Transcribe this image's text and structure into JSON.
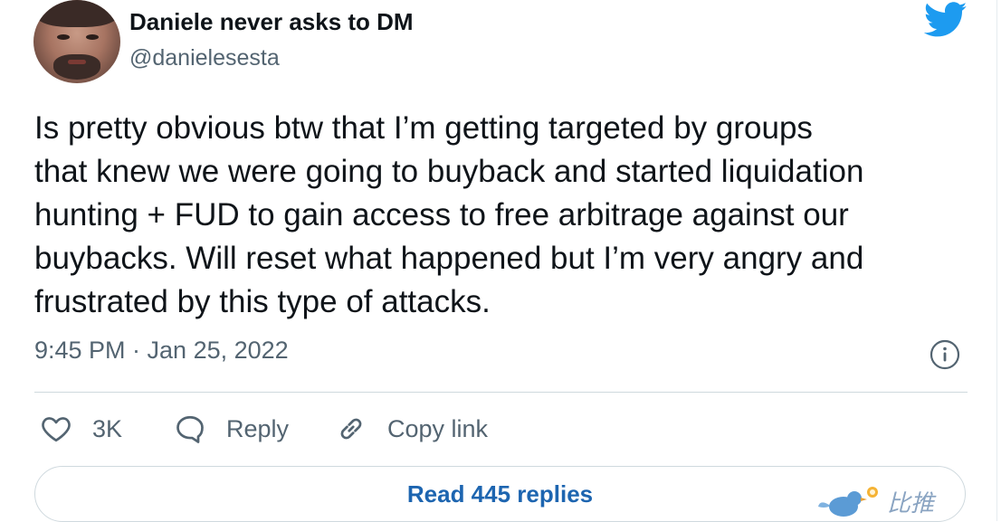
{
  "author": {
    "display_name": "Daniele never asks to DM",
    "handle": "@danielesesta"
  },
  "logo_icon": "twitter-bird-icon",
  "tweet": {
    "lines": [
      "Is pretty obvious btw that I’m getting targeted by groups",
      "that knew we were going to buyback and started liquidation",
      "hunting + FUD to gain access to free arbitrage against our",
      "buybacks. Will reset what happened but I’m very angry and",
      "frustrated by this type of attacks."
    ],
    "timestamp": "9:45 PM · Jan 25, 2022"
  },
  "actions": {
    "like_count": "3K",
    "reply_label": "Reply",
    "copy_label": "Copy link"
  },
  "read_replies_label": "Read 445 replies",
  "watermark": {
    "text": "比推"
  },
  "colors": {
    "twitter_blue": "#1d9bf0",
    "link_blue": "#1d65b0",
    "secondary_text": "#536471"
  }
}
